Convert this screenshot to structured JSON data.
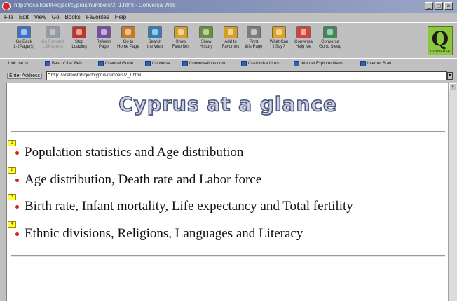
{
  "window": {
    "title": "http://localhost/Project/cyprus/numbers/2_1.html - Conversa Web",
    "controls": [
      "_",
      "□",
      "×"
    ]
  },
  "menu": [
    "File",
    "Edit",
    "View",
    "Go",
    "Books",
    "Favorites",
    "Help"
  ],
  "toolbar": {
    "buttons": [
      {
        "label": "Go Back\n1-2Page(s)",
        "color": "#3a73c9",
        "enabled": true
      },
      {
        "label": "Go Forward\n1-2Page(s)",
        "color": "#6c7a8e",
        "enabled": false
      },
      {
        "label": "Stop\nLoading",
        "color": "#c0342b",
        "enabled": true
      },
      {
        "label": "Refresh\nPage",
        "color": "#7a4ca0",
        "enabled": true
      },
      {
        "label": "Go to\nHome Page",
        "color": "#c87a22",
        "enabled": true
      },
      {
        "label": "Search\nthe Web",
        "color": "#2d7fb8",
        "enabled": true
      },
      {
        "label": "Show\nFavorites",
        "color": "#d4a021",
        "enabled": true
      },
      {
        "label": "Show\nHistory",
        "color": "#6b8f3a",
        "enabled": true
      },
      {
        "label": "Add to\nFavorites",
        "color": "#d4a021",
        "enabled": true
      },
      {
        "label": "Print\nthis Page",
        "color": "#7d7d7d",
        "enabled": true
      },
      {
        "label": "What Can\nI Say?",
        "color": "#e0a020",
        "enabled": true
      },
      {
        "label": "Conversa\nHelp Me",
        "color": "#d6423a",
        "enabled": true
      },
      {
        "label": "Conversa\nGo to Sleep",
        "color": "#3f8a5a",
        "enabled": true
      }
    ],
    "logo_letter": "Q",
    "logo_subtext": "CONVERSA"
  },
  "links_bar": {
    "label": "Link me to...",
    "items": [
      "Best of the Web",
      "Channel Guide",
      "Conversa",
      "Conversations.com",
      "Customize Links",
      "Internet Explorer News",
      "Internet Start"
    ]
  },
  "address": {
    "label": "Enter Address",
    "url": "http://localhost/Project/cyprus/numbers/2_1.html"
  },
  "page": {
    "heading": "Cyprus at a glance",
    "topics": [
      {
        "marker": "1",
        "text": "Population statistics and Age distribution"
      },
      {
        "marker": "2",
        "text": "Age distribution, Death rate and Labor force"
      },
      {
        "marker": "3",
        "text": "Birth rate, Infant mortality, Life expectancy and Total fertility"
      },
      {
        "marker": "4",
        "text": "Ethnic divisions, Religions, Languages and Literacy"
      }
    ]
  },
  "colors": {
    "heading_fill": "#c9cfe4",
    "heading_outline": "#4b5377",
    "bullet": "#d81e1e",
    "marker": "#ffff33"
  }
}
